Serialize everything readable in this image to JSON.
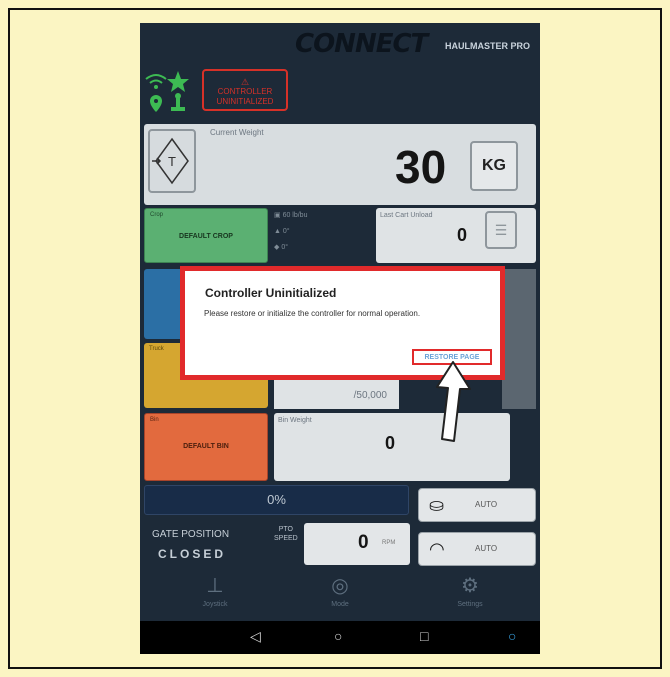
{
  "app": {
    "logo": "CONNECT",
    "model": "HAULMASTER PRO"
  },
  "status": {
    "controller_error": "CONTROLLER UNINITIALIZED"
  },
  "weight": {
    "label": "Current Weight",
    "value": "30",
    "unit": "KG"
  },
  "crop": {
    "label": "Crop",
    "name": "DEFAULT CROP"
  },
  "flow": {
    "rate": "60 lb/bu",
    "angle1": "0°",
    "angle2": "0°"
  },
  "last_unload": {
    "label": "Last Cart Unload",
    "value": "0"
  },
  "truck": {
    "label": "Truck",
    "total": "/50,000"
  },
  "bin": {
    "label": "Bin",
    "name": "DEFAULT BIN",
    "weight_label": "Bin Weight",
    "weight_value": "0"
  },
  "gate": {
    "progress": "0%",
    "position_label": "GATE POSITION",
    "state": "CLOSED"
  },
  "pto": {
    "label_line1": "PTO",
    "label_line2": "SPEED",
    "value": "0",
    "unit": "RPM"
  },
  "auto_buttons": [
    {
      "label": "AUTO",
      "icon": "scale-icon"
    },
    {
      "label": "AUTO",
      "icon": "gauge-icon"
    }
  ],
  "nav": [
    {
      "label": "Joystick",
      "icon": "joystick-icon"
    },
    {
      "label": "Mode",
      "icon": "mode-icon"
    },
    {
      "label": "Settings",
      "icon": "gear-icon"
    }
  ],
  "dialog": {
    "title": "Controller Uninitialized",
    "message": "Please restore or initialize the controller for normal operation.",
    "button": "RESTORE PAGE"
  },
  "colors": {
    "dialog_border": "#e12a2b",
    "crop": "#5bb072",
    "bin": "#e26a3e",
    "truck": "#d5a630",
    "background": "#fbf5c3"
  }
}
